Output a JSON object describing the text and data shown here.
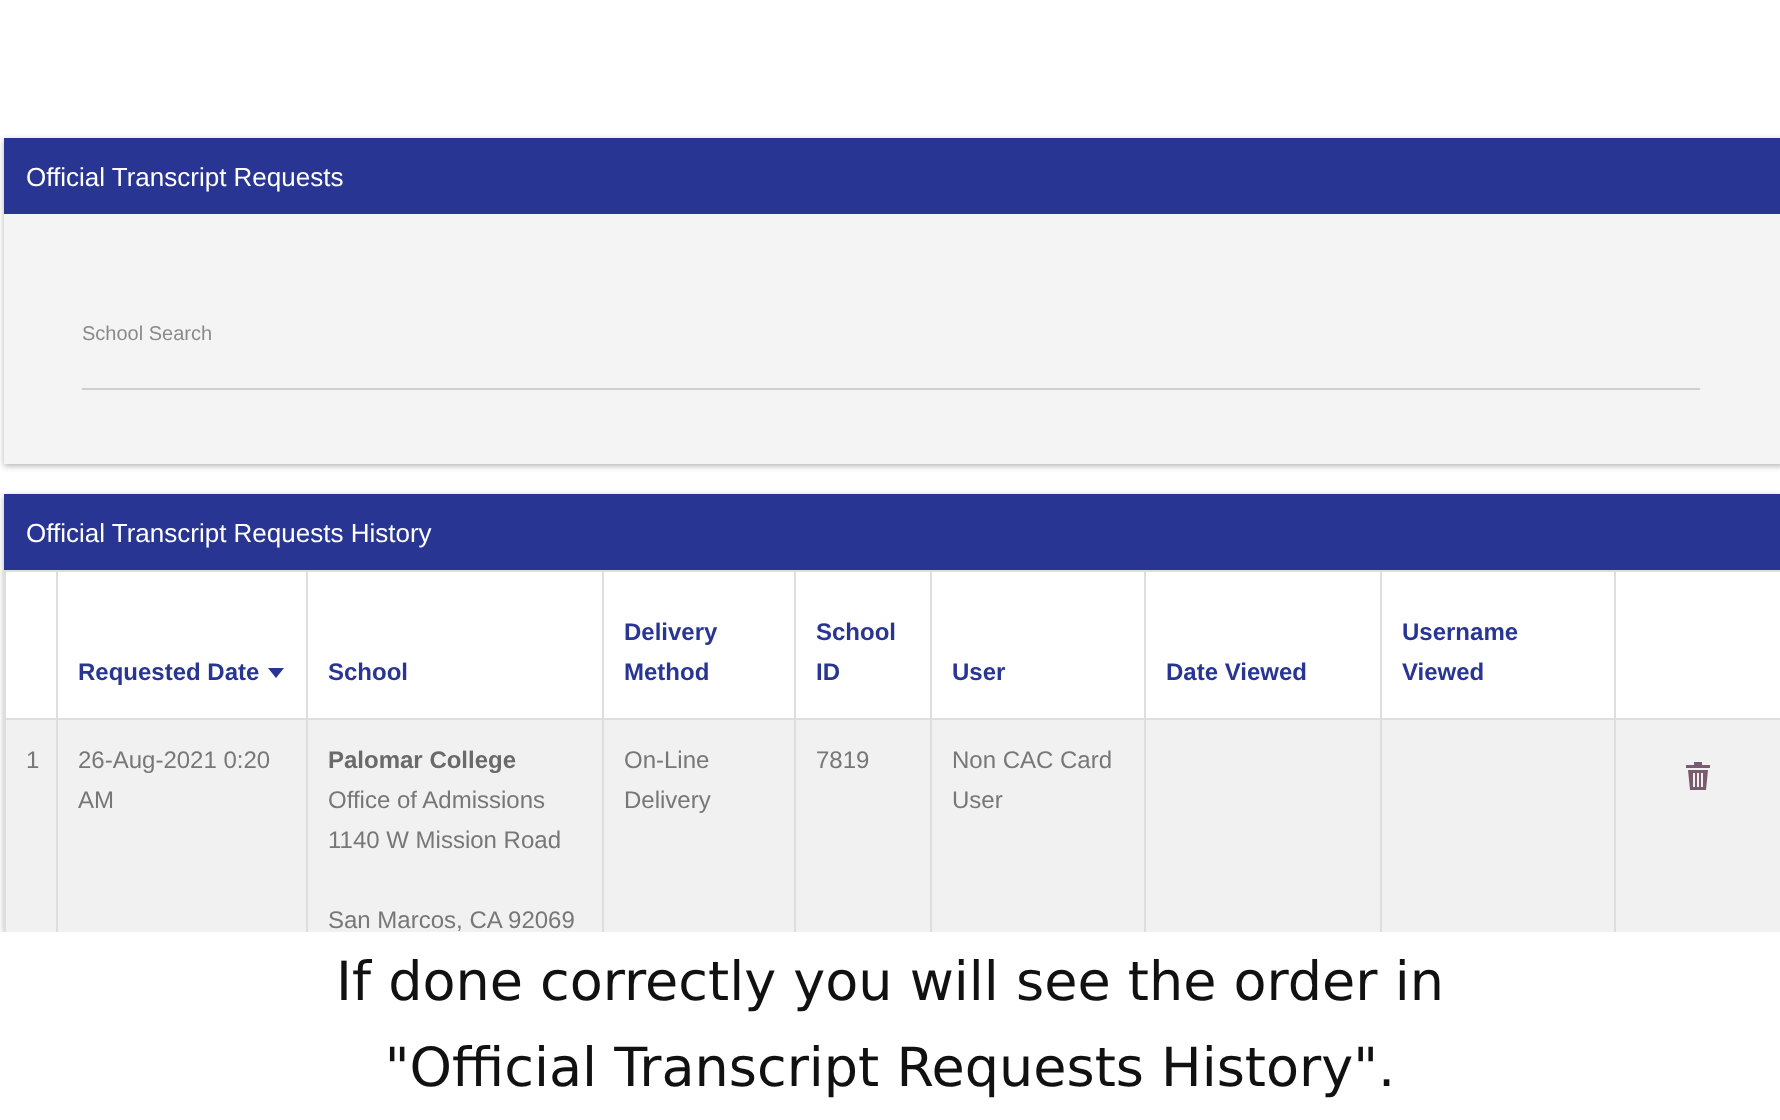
{
  "search_panel": {
    "title": "Official Transcript Requests",
    "field": {
      "label": "School Search"
    }
  },
  "history_panel": {
    "title": "Official Transcript Requests History",
    "columns": [
      {
        "label": "Requested Date",
        "sorted": true
      },
      {
        "label": "School",
        "sorted": false
      },
      {
        "label": "Delivery Method",
        "sorted": false
      },
      {
        "label": "School ID",
        "sorted": false
      },
      {
        "label": "User",
        "sorted": false
      },
      {
        "label": "Date Viewed",
        "sorted": false
      },
      {
        "label": "Username Viewed",
        "sorted": false
      }
    ],
    "rows": [
      {
        "number": "1",
        "requested_date": "26-Aug-2021 0:20 AM",
        "school": {
          "name": "Palomar College",
          "lines": [
            "Office of Admissions",
            "1140 W Mission Road"
          ],
          "city": "San Marcos, CA 92069"
        },
        "delivery_method": "On-Line Delivery",
        "school_id": "7819",
        "user": "Non CAC Card User"
      }
    ]
  },
  "caption": [
    "If done correctly you will see the order in",
    "\"Official Transcript Requests History\"."
  ]
}
